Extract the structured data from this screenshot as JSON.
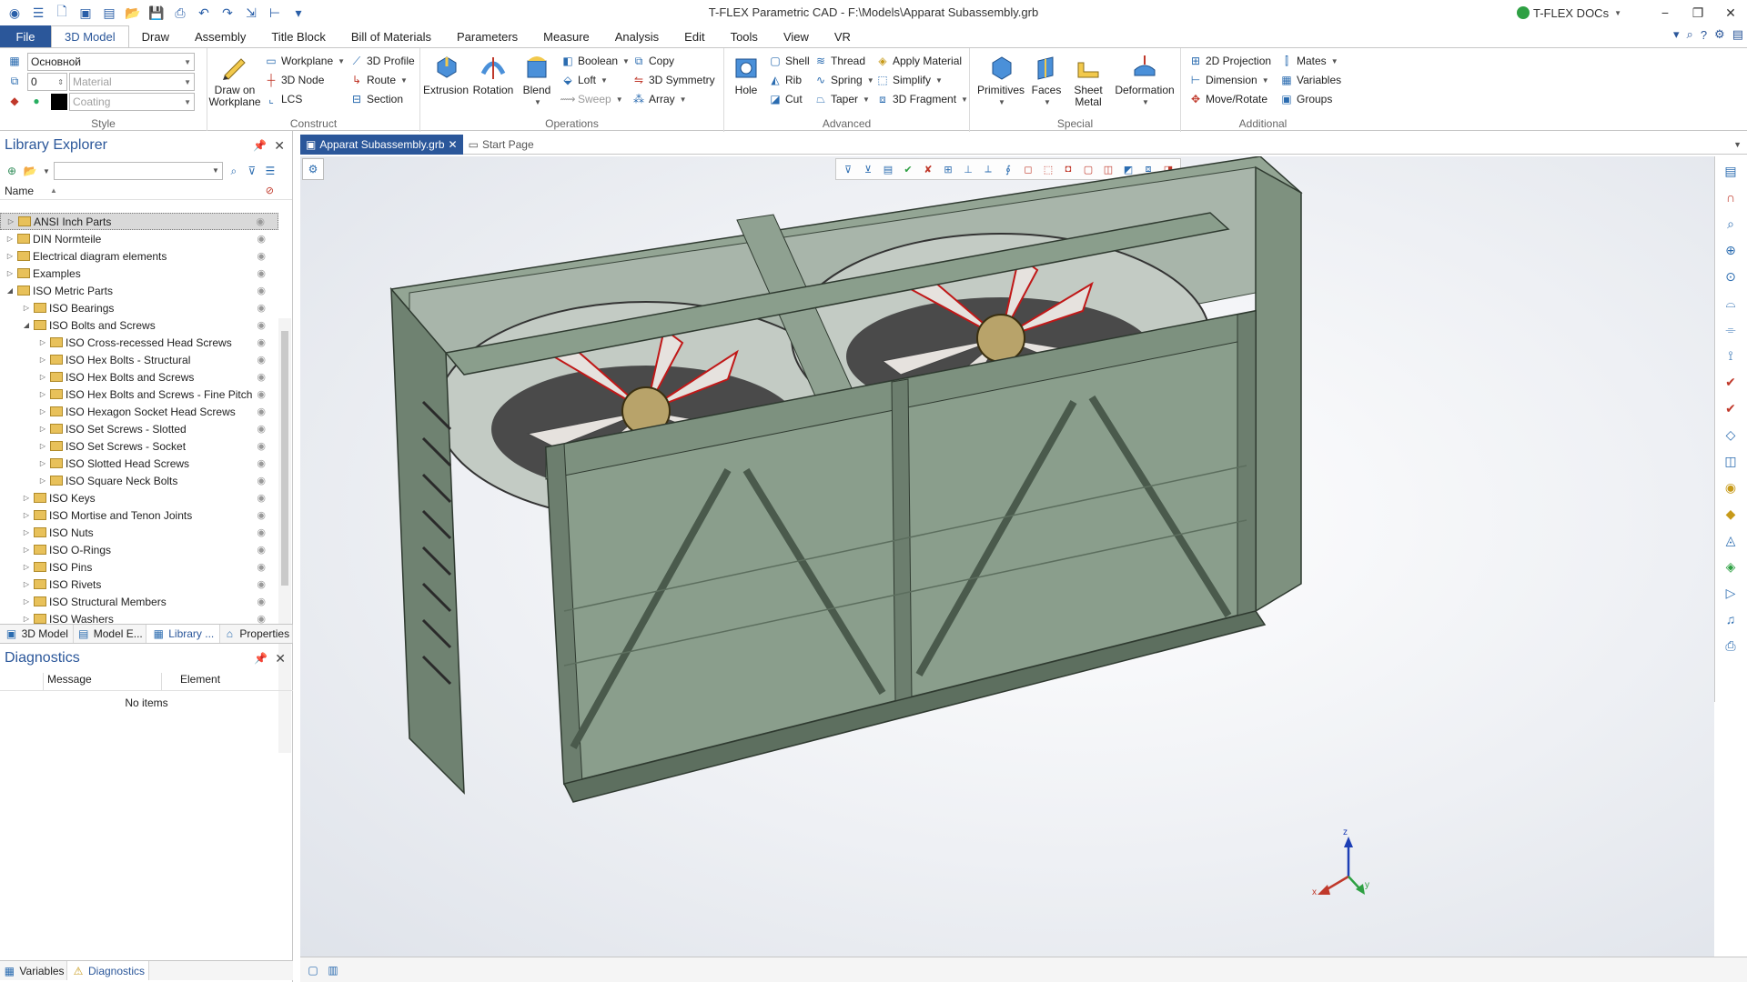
{
  "window": {
    "title": "T-FLEX Parametric CAD - F:\\Models\\Apparat Subassembly.grb",
    "docs_label": "T-FLEX DOCs",
    "minimize": "−",
    "restore": "❐",
    "close": "✕"
  },
  "menu": {
    "tabs": [
      "File",
      "3D Model",
      "Draw",
      "Assembly",
      "Title Block",
      "Bill of Materials",
      "Parameters",
      "Measure",
      "Analysis",
      "Edit",
      "Tools",
      "View",
      "VR"
    ],
    "active": "3D Model"
  },
  "ribbon": {
    "style": {
      "layer_value": "Основной",
      "level_value": "0",
      "material_placeholder": "Material",
      "coating_placeholder": "Coating",
      "label": "Style"
    },
    "construct": {
      "large": "Draw on Workplane",
      "items": [
        "Workplane",
        "3D Node",
        "LCS",
        "3D Profile",
        "Route",
        "Section"
      ],
      "label": "Construct"
    },
    "operations": {
      "large": [
        "Extrusion",
        "Rotation",
        "Blend"
      ],
      "items": [
        "Boolean",
        "Loft",
        "Sweep",
        "Copy",
        "3D Symmetry",
        "Array"
      ],
      "label": "Operations"
    },
    "advanced": {
      "large": "Hole",
      "items": [
        "Shell",
        "Rib",
        "Cut",
        "Thread",
        "Spring",
        "Taper",
        "Apply Material",
        "Simplify",
        "3D Fragment"
      ],
      "label": "Advanced"
    },
    "special": {
      "large": [
        "Primitives",
        "Faces",
        "Sheet Metal",
        "Deformation"
      ],
      "label": "Special"
    },
    "additional": {
      "items": [
        "2D Projection",
        "Dimension",
        "Move/Rotate",
        "Mates",
        "Variables",
        "Groups"
      ],
      "label": "Additional"
    }
  },
  "library_explorer": {
    "title": "Library Explorer",
    "column_name": "Name",
    "items": [
      {
        "label": "ANSI Inch Parts",
        "level": 0,
        "toggle": "▷"
      },
      {
        "label": "DIN Normteile",
        "level": 0,
        "toggle": "▷"
      },
      {
        "label": "Electrical diagram elements",
        "level": 0,
        "toggle": "▷"
      },
      {
        "label": "Examples",
        "level": 0,
        "toggle": "▷"
      },
      {
        "label": "ISO Metric Parts",
        "level": 0,
        "toggle": "◢"
      },
      {
        "label": "ISO Bearings",
        "level": 1,
        "toggle": "▷"
      },
      {
        "label": "ISO Bolts and Screws",
        "level": 1,
        "toggle": "◢"
      },
      {
        "label": "ISO Cross-recessed Head Screws",
        "level": 2,
        "toggle": "▷"
      },
      {
        "label": "ISO Hex Bolts - Structural",
        "level": 2,
        "toggle": "▷"
      },
      {
        "label": "ISO Hex Bolts and Screws",
        "level": 2,
        "toggle": "▷"
      },
      {
        "label": "ISO Hex Bolts and Screws - Fine Pitch",
        "level": 2,
        "toggle": "▷"
      },
      {
        "label": "ISO Hexagon Socket Head Screws",
        "level": 2,
        "toggle": "▷"
      },
      {
        "label": "ISO Set Screws - Slotted",
        "level": 2,
        "toggle": "▷"
      },
      {
        "label": "ISO Set Screws - Socket",
        "level": 2,
        "toggle": "▷"
      },
      {
        "label": "ISO Slotted Head Screws",
        "level": 2,
        "toggle": "▷"
      },
      {
        "label": "ISO Square Neck Bolts",
        "level": 2,
        "toggle": "▷"
      },
      {
        "label": "ISO Keys",
        "level": 1,
        "toggle": "▷"
      },
      {
        "label": "ISO Mortise and Tenon Joints",
        "level": 1,
        "toggle": "▷"
      },
      {
        "label": "ISO Nuts",
        "level": 1,
        "toggle": "▷"
      },
      {
        "label": "ISO O-Rings",
        "level": 1,
        "toggle": "▷"
      },
      {
        "label": "ISO Pins",
        "level": 1,
        "toggle": "▷"
      },
      {
        "label": "ISO Rivets",
        "level": 1,
        "toggle": "▷"
      },
      {
        "label": "ISO Structural Members",
        "level": 1,
        "toggle": "▷"
      },
      {
        "label": "ISO Washers",
        "level": 1,
        "toggle": "▷"
      }
    ]
  },
  "panel_tabs": [
    "3D Model",
    "Model E...",
    "Library ...",
    "Properties"
  ],
  "panel_tabs_active": "Library ...",
  "diagnostics": {
    "title": "Diagnostics",
    "col_message": "Message",
    "col_element": "Element",
    "empty": "No items"
  },
  "bottom_tabs": [
    "Variables",
    "Diagnostics"
  ],
  "document_tabs": {
    "active": "Apparat Subassembly.grb",
    "other": "Start Page"
  },
  "axes": {
    "x": "x",
    "y": "y",
    "z": "z"
  },
  "colors": {
    "accent": "#2b579a",
    "model_green": "#8a9e8c",
    "fan_red": "#d02020"
  }
}
